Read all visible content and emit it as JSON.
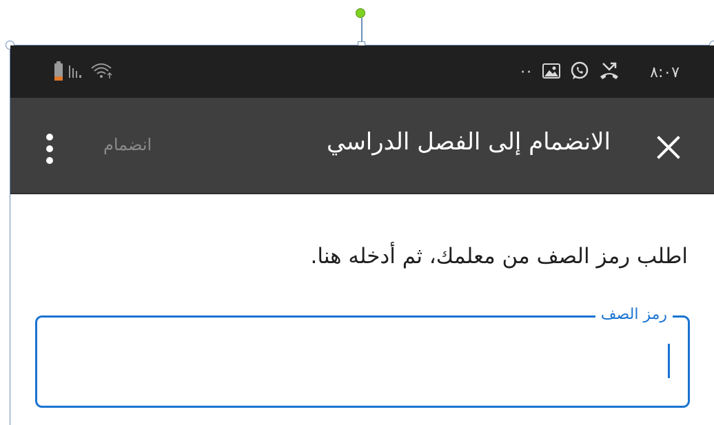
{
  "status_bar": {
    "time": "٨:٠٧",
    "overflow_dots": "··",
    "icons": [
      "battery-icon",
      "signal-bars-icon",
      "wifi-icon",
      "image-icon",
      "whatsapp-icon",
      "missed-call-icon"
    ]
  },
  "app_bar": {
    "title": "الانضمام إلى الفصل الدراسي",
    "join_label": "انضمام",
    "close_icon": "close-icon",
    "menu_icon": "more-vertical-icon"
  },
  "content": {
    "instruction": "اطلب رمز الصف من معلمك، ثم أدخله هنا.",
    "class_code": {
      "label": "رمز الصف",
      "value": ""
    }
  },
  "colors": {
    "status_bar_bg": "#202020",
    "app_bar_bg": "#3f3f3f",
    "accent": "#1a73d1",
    "handle_green": "#7ed321"
  }
}
